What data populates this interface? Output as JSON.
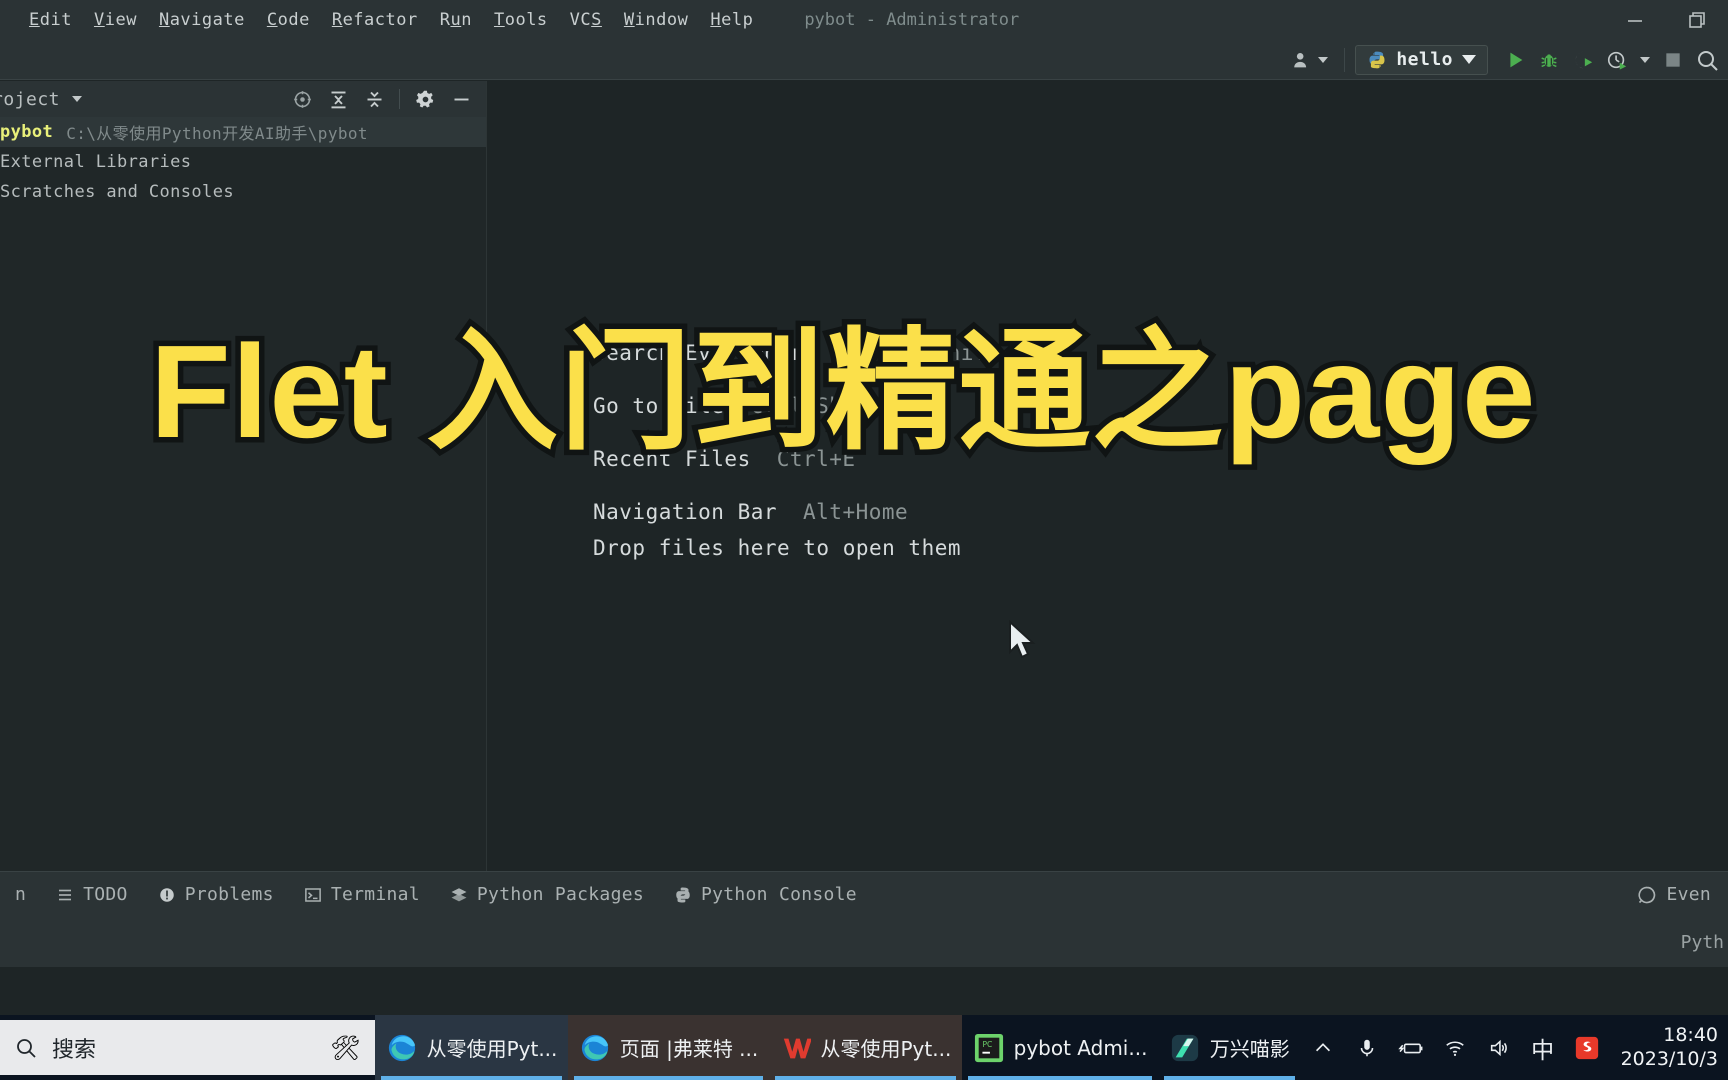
{
  "window": {
    "title": "pybot - Administrator",
    "menu": [
      {
        "label": "Edit",
        "mnemonic": "E"
      },
      {
        "label": "View",
        "mnemonic": "V"
      },
      {
        "label": "Navigate",
        "mnemonic": "N"
      },
      {
        "label": "Code",
        "mnemonic": "C"
      },
      {
        "label": "Refactor",
        "mnemonic": "R"
      },
      {
        "label": "Run",
        "mnemonic": "u"
      },
      {
        "label": "Tools",
        "mnemonic": "T"
      },
      {
        "label": "VCS",
        "mnemonic": "S"
      },
      {
        "label": "Window",
        "mnemonic": "W"
      },
      {
        "label": "Help",
        "mnemonic": "H"
      }
    ],
    "controls": {
      "minimize": "minimize-icon",
      "restore": "restore-icon"
    }
  },
  "toolbar": {
    "account_icon": "person-icon",
    "run_config": {
      "label": "hello",
      "icon": "python-icon",
      "caret": "chevron-down-icon"
    },
    "buttons": [
      {
        "name": "run-button",
        "icon": "play-icon"
      },
      {
        "name": "debug-button",
        "icon": "bug-icon"
      },
      {
        "name": "run-with-coverage-button",
        "icon": "coverage-icon"
      },
      {
        "name": "profile-button",
        "icon": "profiler-icon"
      },
      {
        "name": "stop-button",
        "icon": "stop-icon"
      },
      {
        "name": "search-everywhere-button",
        "icon": "search-icon"
      }
    ]
  },
  "project_panel": {
    "title": "roject",
    "header_icons": [
      {
        "name": "select-opened-file-icon"
      },
      {
        "name": "expand-all-icon"
      },
      {
        "name": "collapse-all-icon"
      },
      {
        "name": "settings-gear-icon"
      },
      {
        "name": "hide-panel-icon"
      }
    ],
    "tree": [
      {
        "name": "pybot",
        "path": "C:\\从零使用Python开发AI助手\\pybot",
        "selected": true
      },
      {
        "name": "External Libraries",
        "path": "",
        "selected": false
      },
      {
        "name": "Scratches and Consoles",
        "path": "",
        "selected": false
      }
    ]
  },
  "editor": {
    "empty_state": [
      {
        "action": "Search Everywhere",
        "shortcut": "Double Shift"
      },
      {
        "action": "Go to File",
        "shortcut": "Ctrl+Shift+N"
      },
      {
        "action": "Recent Files",
        "shortcut": "Ctrl+E"
      },
      {
        "action": "Navigation Bar",
        "shortcut": "Alt+Home"
      }
    ],
    "drop_hint": "Drop files here to open them"
  },
  "overlay": {
    "text": "Flet 入门到精通之page",
    "color": "#fbe04a",
    "stroke_color": "#101414"
  },
  "bottom_bar": {
    "items": [
      {
        "label": "n",
        "icon": "run-icon"
      },
      {
        "label": "TODO",
        "icon": "todo-icon"
      },
      {
        "label": "Problems",
        "icon": "problems-icon"
      },
      {
        "label": "Terminal",
        "icon": "terminal-icon"
      },
      {
        "label": "Python Packages",
        "icon": "packages-icon"
      },
      {
        "label": "Python Console",
        "icon": "python-console-icon"
      }
    ],
    "right": {
      "label": "Even",
      "icon": "event-log-icon"
    }
  },
  "status_bar": {
    "interpreter": "Pyth"
  },
  "taskbar": {
    "search": {
      "placeholder": "搜索",
      "icon": "search-icon",
      "tools_icon": "tools-icon"
    },
    "apps": [
      {
        "label": "从零使用Pyt...",
        "icon": "edge-icon",
        "state": "active"
      },
      {
        "label": "页面 |弗莱特 ...",
        "icon": "edge-icon",
        "state": "tinted"
      },
      {
        "label": "从零使用Pyt...",
        "icon": "wps-icon",
        "state": "tinted"
      },
      {
        "label": "pybot Admi...",
        "icon": "pycharm-icon",
        "state": "normal"
      },
      {
        "label": "万兴喵影",
        "icon": "filmora-icon",
        "state": "normal"
      }
    ],
    "tray": [
      {
        "name": "show-hidden-icons",
        "icon": "chevron-up-icon"
      },
      {
        "name": "microphone",
        "icon": "microphone-icon"
      },
      {
        "name": "battery",
        "icon": "battery-charging-icon"
      },
      {
        "name": "network",
        "icon": "wifi-icon"
      },
      {
        "name": "volume",
        "icon": "speaker-icon"
      },
      {
        "name": "ime-mode",
        "icon": "ime-chinese-icon",
        "label": "中"
      },
      {
        "name": "sogou-input",
        "icon": "sogou-icon"
      }
    ],
    "clock": {
      "time": "18:40",
      "date": "2023/10/3"
    }
  }
}
